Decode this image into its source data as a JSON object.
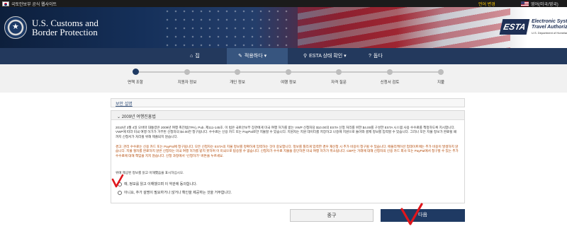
{
  "topbar": {
    "gov_site": "국토안보부 공식 웹사이트",
    "lang_change": "언어 변경",
    "lang_selected": "영어(미국/영국)"
  },
  "header": {
    "agency_line1": "U.S. Customs and",
    "agency_line2": "Border Protection",
    "esta_logo": "ESTA",
    "esta_line1": "Electronic System fo",
    "esta_line2": "Travel Authorizatio",
    "esta_sub": "U.S. Department of Homeland Security"
  },
  "nav": {
    "items": [
      {
        "icon": "home-icon",
        "glyph": "⌂",
        "label": "집"
      },
      {
        "icon": "pencil-icon",
        "glyph": "✎",
        "label": "적용하다 ▾"
      },
      {
        "icon": "search-icon",
        "glyph": "⚲",
        "label": "ESTA 상태 확인 ▾"
      },
      {
        "icon": "help-icon",
        "glyph": "?",
        "label": "돕다"
      }
    ]
  },
  "progress": {
    "steps": [
      "면책 조항",
      "지원자 정보",
      "개인 정보",
      "여행 정보",
      "자격 질문",
      "신청서 검토",
      "지불"
    ],
    "current_index": 0
  },
  "help_panel": {
    "label": "보안 설명"
  },
  "law_panel": {
    "title": "2009년 여행진흥법",
    "paragraph1": "2010년 3월 4일 오바마 대통령은 2009년 여행 촉진법(TPA), Pub. 제111-145호. 이 법은 국토안보부 장관에게 미국 여행 허가를 받는 VWP 신청자당 $10.00의 ESTA 신청 처리를 위한 $4.00를 구성한 ESTA 시스템 사용 수수료를 책정하도록 지시합니다. VWP에 따라 미국 여행 허가가 거부된 신청자의 $4.00만 청구됩니다. 수수료는 신용 카드 또는 PayPal로만 지불할 수 있습니다. 지원자는 지원 데이터를 저장하고 나중에 지원으로 돌아와 결제 정보를 입력할 수 있습니다. 그러나 모든 지불 정보가 완료될 때까지 신청서가 처리될 위해 제출되지 않습니다.",
    "paragraph2": "경고: 관리 수수료는 신용 카드 또는 PayPal에 청구됩니다. 모든 신청자는 ESTA의 지불 정보를 정확하게 입력하는 것이 중요합니다. 정보를 틀리게 입력한 경우 재신청 시 추가 비용이 청구될 수 있습니다. 애플리케이션 업데이트에는 추가 비용이 발생하지 않습니다. 지불 절차를 완료하지 않은 신청자는 미국 여행 허가를 받지 못하며 이 미국으로 탑승할 수 없습니다. 신청자가 수수료 지불을 중단하면 미국 여행 허가가 취소됩니다. CBP는 거래에 대해 신청자의 신용 카드 회사 또는 PayPal에서 청구할 수 있는 추가 수수료에 대해 책임을 지지 않습니다. 신청 과정에서 \"신청하기\" 버튼을 누르세요.",
    "instruction": "위에 제공된 정보를 읽고 이해했음을 표시하십시오.",
    "option_yes": "예, 정보를 읽고 이해했으며 이 약관에 동의합니다.",
    "option_no": "아니요, 추가 설명이 필요하거나 않거나 확인을 제공하는 것을 거부합니다."
  },
  "buttons": {
    "cancel": "종구",
    "next": "다음"
  },
  "colors": {
    "nav": "#23395d",
    "primary_button": "#1f3a63",
    "annotation_red": "#e0161c"
  }
}
